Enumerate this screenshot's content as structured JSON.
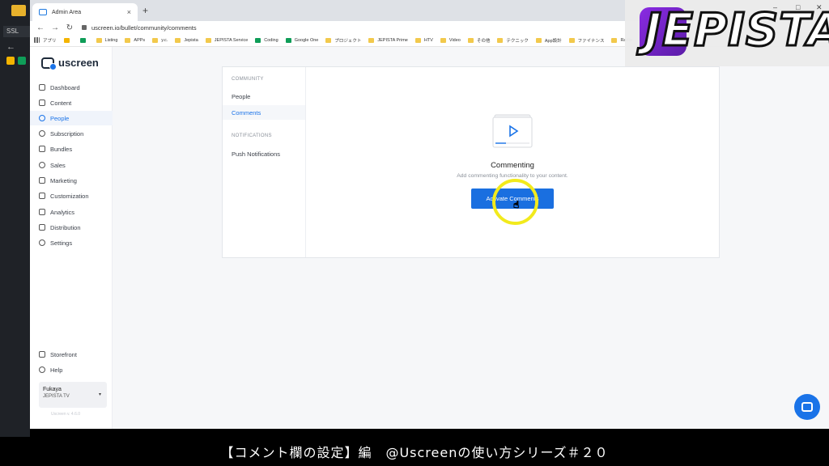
{
  "background_window": {
    "tab_label": "SSL"
  },
  "browser": {
    "tab_title": "Admin Area",
    "new_tab_symbol": "+",
    "close_symbol": "×",
    "url": "uscreen.io/bullet/community/comments",
    "bookmarks": [
      "アプリ",
      "Listing",
      "APPs",
      "y.c.",
      "Jepista",
      "JEPISTA Service",
      "Coding",
      "Google One",
      "プロジェクト",
      "JEPISTA Prime",
      "HTV",
      "Video",
      "その他",
      "テクニック",
      "App設計",
      "ファイナンス",
      "Radio"
    ]
  },
  "overlay_logo": {
    "text": "JEPISTA"
  },
  "sidebar": {
    "brand": "uscreen",
    "items": [
      {
        "label": "Dashboard",
        "icon": "grid-icon"
      },
      {
        "label": "Content",
        "icon": "folder-icon"
      },
      {
        "label": "People",
        "icon": "people-icon",
        "active": true
      },
      {
        "label": "Subscription",
        "icon": "refresh-icon"
      },
      {
        "label": "Bundles",
        "icon": "box-icon"
      },
      {
        "label": "Sales",
        "icon": "dollar-icon"
      },
      {
        "label": "Marketing",
        "icon": "megaphone-icon"
      },
      {
        "label": "Customization",
        "icon": "edit-icon"
      },
      {
        "label": "Analytics",
        "icon": "chart-icon"
      },
      {
        "label": "Distribution",
        "icon": "share-icon"
      },
      {
        "label": "Settings",
        "icon": "gear-icon"
      }
    ],
    "bottom_items": [
      {
        "label": "Storefront",
        "icon": "storefront-icon"
      },
      {
        "label": "Help",
        "icon": "help-icon"
      }
    ],
    "user": {
      "name": "Fukaya",
      "subtitle": "JEPISTA TV"
    },
    "version": "Uscreen v. 4.6.0"
  },
  "subnav": {
    "community_heading": "COMMUNITY",
    "people": "People",
    "comments": "Comments",
    "notifications_heading": "NOTIFICATIONS",
    "push": "Push Notifications"
  },
  "empty_state": {
    "title": "Commenting",
    "description": "Add commenting functionality to your content.",
    "button": "Activate Comments"
  },
  "caption": "【コメント欄の設定】編　@Uscreenの使い方シリーズ＃２０",
  "colors": {
    "accent": "#1a73e8",
    "highlight": "#f2ea1c",
    "logo_purple": "#8a2be2"
  }
}
